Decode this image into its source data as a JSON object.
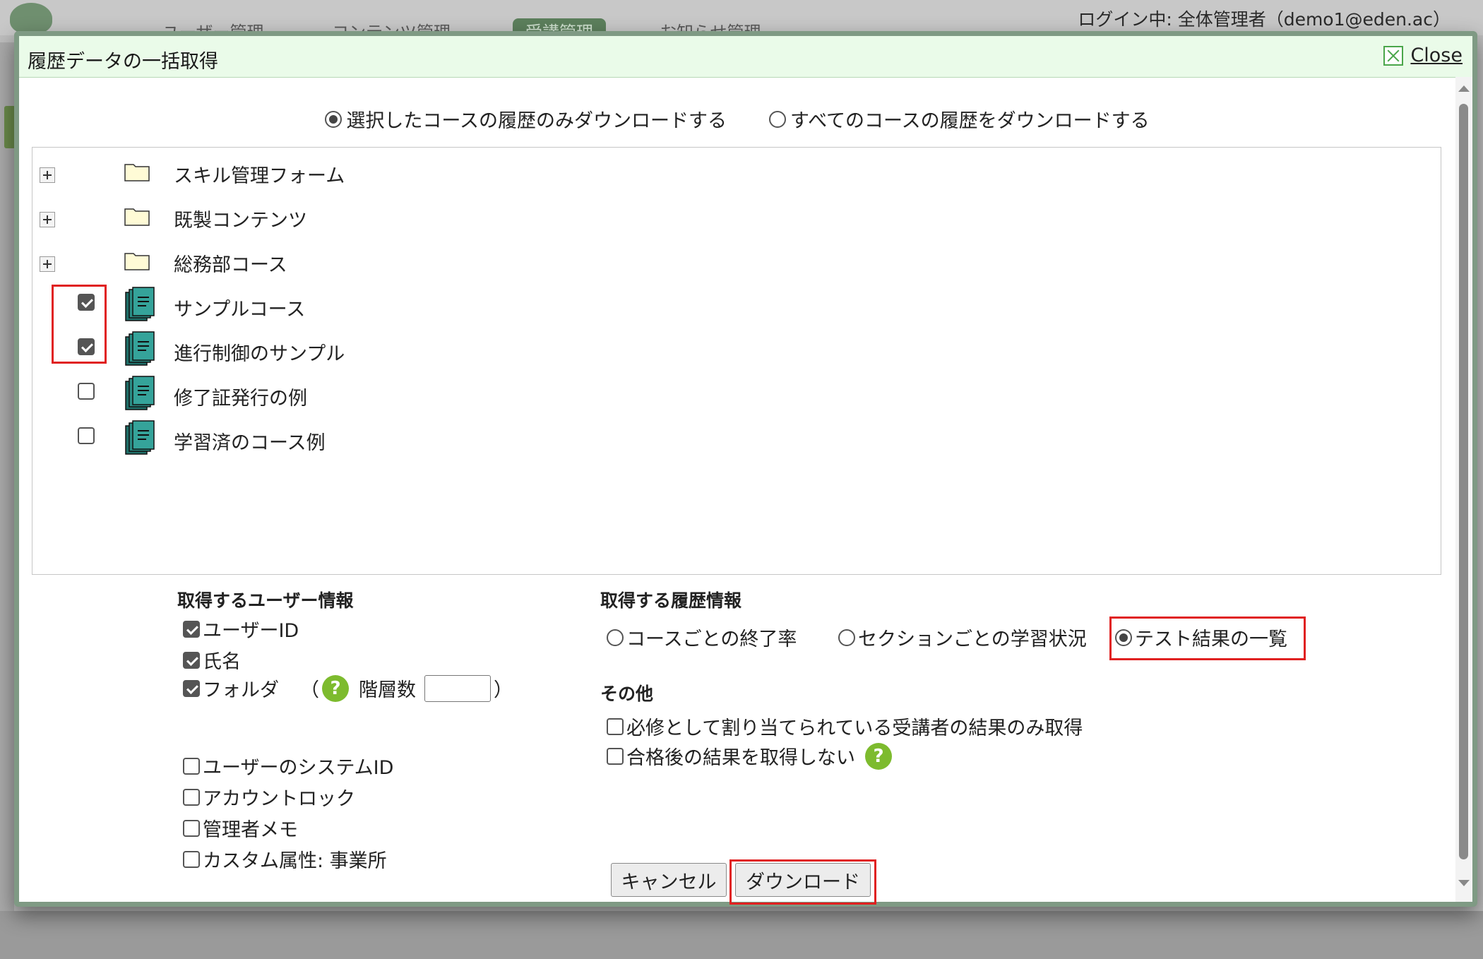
{
  "background_app": {
    "tabs": [
      "ユーザー管理",
      "コンテンツ管理",
      "受講管理",
      "お知らせ管理"
    ],
    "login_text": "ログイン中: 全体管理者（demo1@eden.ac）"
  },
  "dialog": {
    "title": "履歴データの一括取得",
    "close_label": "Close",
    "scope_options": [
      {
        "label": "選択したコースの履歴のみダウンロードする",
        "selected": true
      },
      {
        "label": "すべてのコースの履歴をダウンロードする",
        "selected": false
      }
    ],
    "tree": [
      {
        "type": "folder",
        "label": "スキル管理フォーム",
        "icon": "folder-icon"
      },
      {
        "type": "folder",
        "label": "既製コンテンツ",
        "icon": "folder-icon"
      },
      {
        "type": "folder",
        "label": "総務部コース",
        "icon": "folder-icon"
      },
      {
        "type": "course",
        "label": "サンプルコース",
        "checked": true,
        "icon": "course-icon"
      },
      {
        "type": "course",
        "label": "進行制御のサンプル",
        "checked": true,
        "icon": "course-icon"
      },
      {
        "type": "course",
        "label": "修了証発行の例",
        "checked": false,
        "icon": "course-icon"
      },
      {
        "type": "course",
        "label": "学習済のコース例",
        "checked": false,
        "icon": "course-icon"
      }
    ],
    "user_info": {
      "title": "取得するユーザー情報",
      "items": [
        {
          "label": "ユーザーID",
          "checked": true
        },
        {
          "label": "氏名",
          "checked": true
        },
        {
          "label": "フォルダ",
          "checked": true
        },
        {
          "label": "ユーザーのシステムID",
          "checked": false
        },
        {
          "label": "アカウントロック",
          "checked": false
        },
        {
          "label": "管理者メモ",
          "checked": false
        },
        {
          "label": "カスタム属性: 事業所",
          "checked": false
        }
      ],
      "folder_open_paren": "（",
      "folder_close_paren": "）",
      "depth_label": "階層数",
      "depth_value": ""
    },
    "history_info": {
      "title": "取得する履歴情報",
      "options": [
        {
          "label": "コースごとの終了率",
          "selected": false
        },
        {
          "label": "セクションごとの学習状況",
          "selected": false
        },
        {
          "label": "テスト結果の一覧",
          "selected": true
        }
      ]
    },
    "other": {
      "title": "その他",
      "items": [
        {
          "label": "必修として割り当てられている受講者の結果のみ取得",
          "checked": false
        },
        {
          "label": "合格後の結果を取得しない",
          "checked": false
        }
      ]
    },
    "help_glyph": "?",
    "buttons": {
      "cancel": "キャンセル",
      "download": "ダウンロード"
    }
  },
  "colors": {
    "highlight": "#e02020",
    "titlebar": "#eafbe9",
    "help": "#7dbb2e",
    "course_icon": "#2a8c84"
  }
}
